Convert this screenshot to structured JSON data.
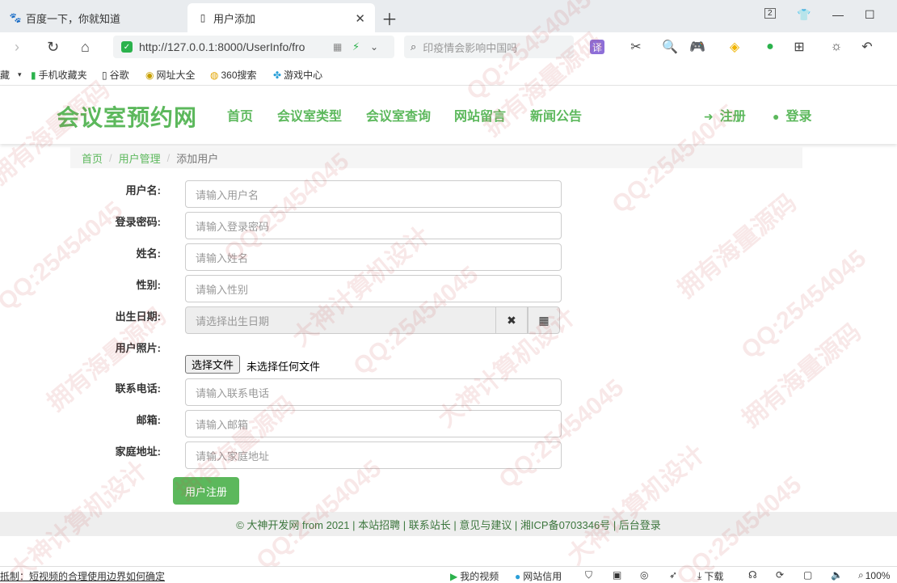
{
  "browser": {
    "tabs": [
      {
        "label": "百度一下，你就知道",
        "active": false
      },
      {
        "label": "用户添加",
        "active": true
      }
    ],
    "tab_counter": "2",
    "url": "http://127.0.0.1:8000/UserInfo/fro",
    "search_placeholder": "印疫情会影响中国吗",
    "bookmarks": [
      "藏",
      "手机收藏夹",
      "谷歌",
      "网址大全",
      "360搜索",
      "游戏中心"
    ]
  },
  "site": {
    "logo": "会议室预约网",
    "nav": [
      "首页",
      "会议室类型",
      "会议室查询",
      "网站留言",
      "新闻公告"
    ],
    "register": "注册",
    "login": "登录",
    "accent_color": "#5cb85c"
  },
  "breadcrumb": [
    "首页",
    "用户管理",
    "添加用户"
  ],
  "form": {
    "username": {
      "label": "用户名:",
      "placeholder": "请输入用户名"
    },
    "password": {
      "label": "登录密码:",
      "placeholder": "请输入登录密码"
    },
    "name": {
      "label": "姓名:",
      "placeholder": "请输入姓名"
    },
    "gender": {
      "label": "性别:",
      "placeholder": "请输入性别"
    },
    "birthday": {
      "label": "出生日期:",
      "placeholder": "请选择出生日期"
    },
    "photo": {
      "label": "用户照片:",
      "button": "选择文件",
      "status": "未选择任何文件"
    },
    "phone": {
      "label": "联系电话:",
      "placeholder": "请输入联系电话"
    },
    "email": {
      "label": "邮箱:",
      "placeholder": "请输入邮箱"
    },
    "address": {
      "label": "家庭地址:",
      "placeholder": "请输入家庭地址"
    },
    "submit": "用户注册"
  },
  "footer": "© 大神开发网 from 2021 | 本站招聘 | 联系站长 | 意见与建议 | 湘ICP备0703346号 | 后台登录",
  "statusbar": {
    "left": "抵制：短视频的合理使用边界如何确定",
    "my_video": "我的视频",
    "site_credit": "网站信用",
    "download": "下载",
    "zoom": "100%"
  },
  "watermark": [
    "QQ:25454045",
    "大神计算机设计",
    "拥有海量源码"
  ]
}
